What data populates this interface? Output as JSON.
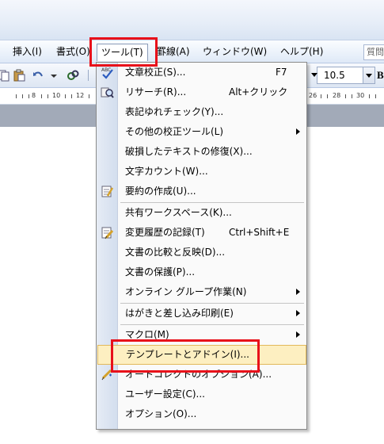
{
  "menubar": {
    "items": [
      {
        "label": "挿入(I)"
      },
      {
        "label": "書式(O)"
      },
      {
        "label": "ツール(T)"
      },
      {
        "label": "罫線(A)"
      },
      {
        "label": "ウィンドウ(W)"
      },
      {
        "label": "ヘルプ(H)"
      }
    ],
    "help_placeholder": "質問"
  },
  "toolbar": {
    "font_size": "10.5",
    "bold_label": "B"
  },
  "ruler": {
    "numbers": [
      "8",
      "10",
      "12",
      "26",
      "28",
      "30"
    ]
  },
  "tools_menu": {
    "items": [
      {
        "label": "文章校正(S)...",
        "shortcut": "F7"
      },
      {
        "label": "リサーチ(R)...",
        "shortcut": "Alt+クリック"
      },
      {
        "label": "表記ゆれチェック(Y)...",
        "shortcut": ""
      },
      {
        "label": "その他の校正ツール(L)",
        "shortcut": ""
      },
      {
        "label": "破損したテキストの修復(X)...",
        "shortcut": ""
      },
      {
        "label": "文字カウント(W)...",
        "shortcut": ""
      },
      {
        "label": "要約の作成(U)...",
        "shortcut": ""
      },
      {
        "label": "共有ワークスペース(K)...",
        "shortcut": ""
      },
      {
        "label": "変更履歴の記録(T)",
        "shortcut": "Ctrl+Shift+E"
      },
      {
        "label": "文書の比較と反映(D)...",
        "shortcut": ""
      },
      {
        "label": "文書の保護(P)...",
        "shortcut": ""
      },
      {
        "label": "オンライン グループ作業(N)",
        "shortcut": ""
      },
      {
        "label": "はがきと差し込み印刷(E)",
        "shortcut": ""
      },
      {
        "label": "マクロ(M)",
        "shortcut": ""
      },
      {
        "label": "テンプレートとアドイン(I)...",
        "shortcut": ""
      },
      {
        "label": "オートコレクトのオプション(A)...",
        "shortcut": ""
      },
      {
        "label": "ユーザー設定(C)...",
        "shortcut": ""
      },
      {
        "label": "オプション(O)...",
        "shortcut": ""
      }
    ],
    "highlighted_item": "テンプレートとアドイン(I)..."
  },
  "colors": {
    "highlight_fill": "#fdefc1",
    "highlight_border": "#e2b95b",
    "annotation_red": "#e8101a"
  }
}
